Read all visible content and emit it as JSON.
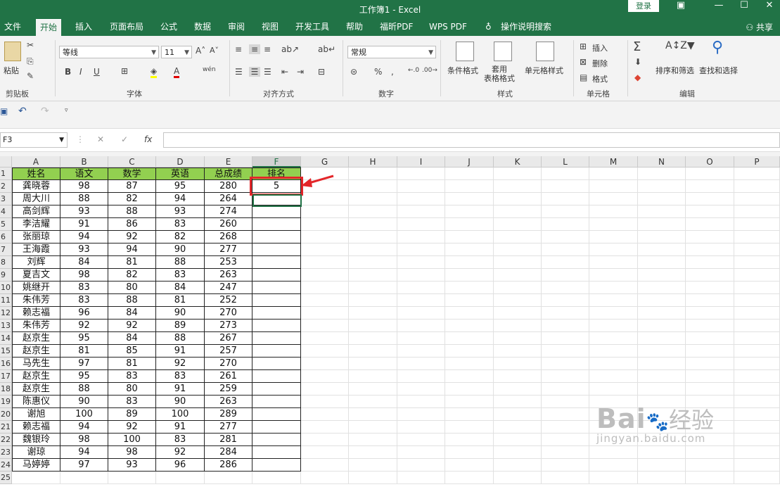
{
  "window": {
    "title": "工作簿1  -  Excel",
    "login": "登录"
  },
  "menu": {
    "tabs": [
      "文件",
      "开始",
      "插入",
      "页面布局",
      "公式",
      "数据",
      "审阅",
      "视图",
      "开发工具",
      "帮助",
      "福昕PDF",
      "WPS PDF",
      "操作说明搜索"
    ],
    "share": "共享"
  },
  "ribbon": {
    "paste": "粘贴",
    "font_name": "等线",
    "font_size": "11",
    "number_format": "常规",
    "cond_format": "条件格式",
    "table_format": "套用\n表格格式",
    "cell_style": "单元格样式",
    "insert": "插入",
    "delete": "删除",
    "format": "格式",
    "sort_filter": "排序和筛选",
    "find_select": "查找和选择",
    "groups": {
      "clipboard": "剪贴板",
      "font": "字体",
      "align": "对齐方式",
      "number": "数字",
      "styles": "样式",
      "cells": "单元格",
      "editing": "编辑"
    }
  },
  "formula_bar": {
    "name_box": "F3",
    "formula": ""
  },
  "sheet": {
    "columns": [
      "A",
      "B",
      "C",
      "D",
      "E",
      "F",
      "G",
      "H",
      "I",
      "J",
      "K",
      "L",
      "M",
      "N",
      "O",
      "P"
    ],
    "headers": [
      "姓名",
      "语文",
      "数学",
      "英语",
      "总成绩",
      "排名"
    ],
    "rows": [
      [
        "龚晓蓉",
        "98",
        "87",
        "95",
        "280",
        "5"
      ],
      [
        "周大川",
        "88",
        "82",
        "94",
        "264",
        ""
      ],
      [
        "高剑辉",
        "93",
        "88",
        "93",
        "274",
        ""
      ],
      [
        "李洁耀",
        "91",
        "86",
        "83",
        "260",
        ""
      ],
      [
        "张丽琼",
        "94",
        "92",
        "82",
        "268",
        ""
      ],
      [
        "王海霞",
        "93",
        "94",
        "90",
        "277",
        ""
      ],
      [
        "刘辉",
        "84",
        "81",
        "88",
        "253",
        ""
      ],
      [
        "夏吉文",
        "98",
        "82",
        "83",
        "263",
        ""
      ],
      [
        "姚继开",
        "83",
        "80",
        "84",
        "247",
        ""
      ],
      [
        "朱伟芳",
        "83",
        "88",
        "81",
        "252",
        ""
      ],
      [
        "赖志福",
        "96",
        "84",
        "90",
        "270",
        ""
      ],
      [
        "朱伟芳",
        "92",
        "92",
        "89",
        "273",
        ""
      ],
      [
        "赵京生",
        "95",
        "84",
        "88",
        "267",
        ""
      ],
      [
        "赵京生",
        "81",
        "85",
        "91",
        "257",
        ""
      ],
      [
        "马先生",
        "97",
        "81",
        "92",
        "270",
        ""
      ],
      [
        "赵京生",
        "95",
        "83",
        "83",
        "261",
        ""
      ],
      [
        "赵京生",
        "88",
        "80",
        "91",
        "259",
        ""
      ],
      [
        "陈惠仪",
        "90",
        "83",
        "90",
        "263",
        ""
      ],
      [
        "谢旭",
        "100",
        "89",
        "100",
        "289",
        ""
      ],
      [
        "赖志福",
        "94",
        "92",
        "91",
        "277",
        ""
      ],
      [
        "魏银玲",
        "98",
        "100",
        "83",
        "281",
        ""
      ],
      [
        "谢琼",
        "94",
        "98",
        "92",
        "284",
        ""
      ],
      [
        "马婷婷",
        "97",
        "93",
        "96",
        "286",
        ""
      ]
    ]
  },
  "watermark": {
    "brand": "Bai",
    "brand2": "经验",
    "url": "jingyan.baidu.com"
  }
}
